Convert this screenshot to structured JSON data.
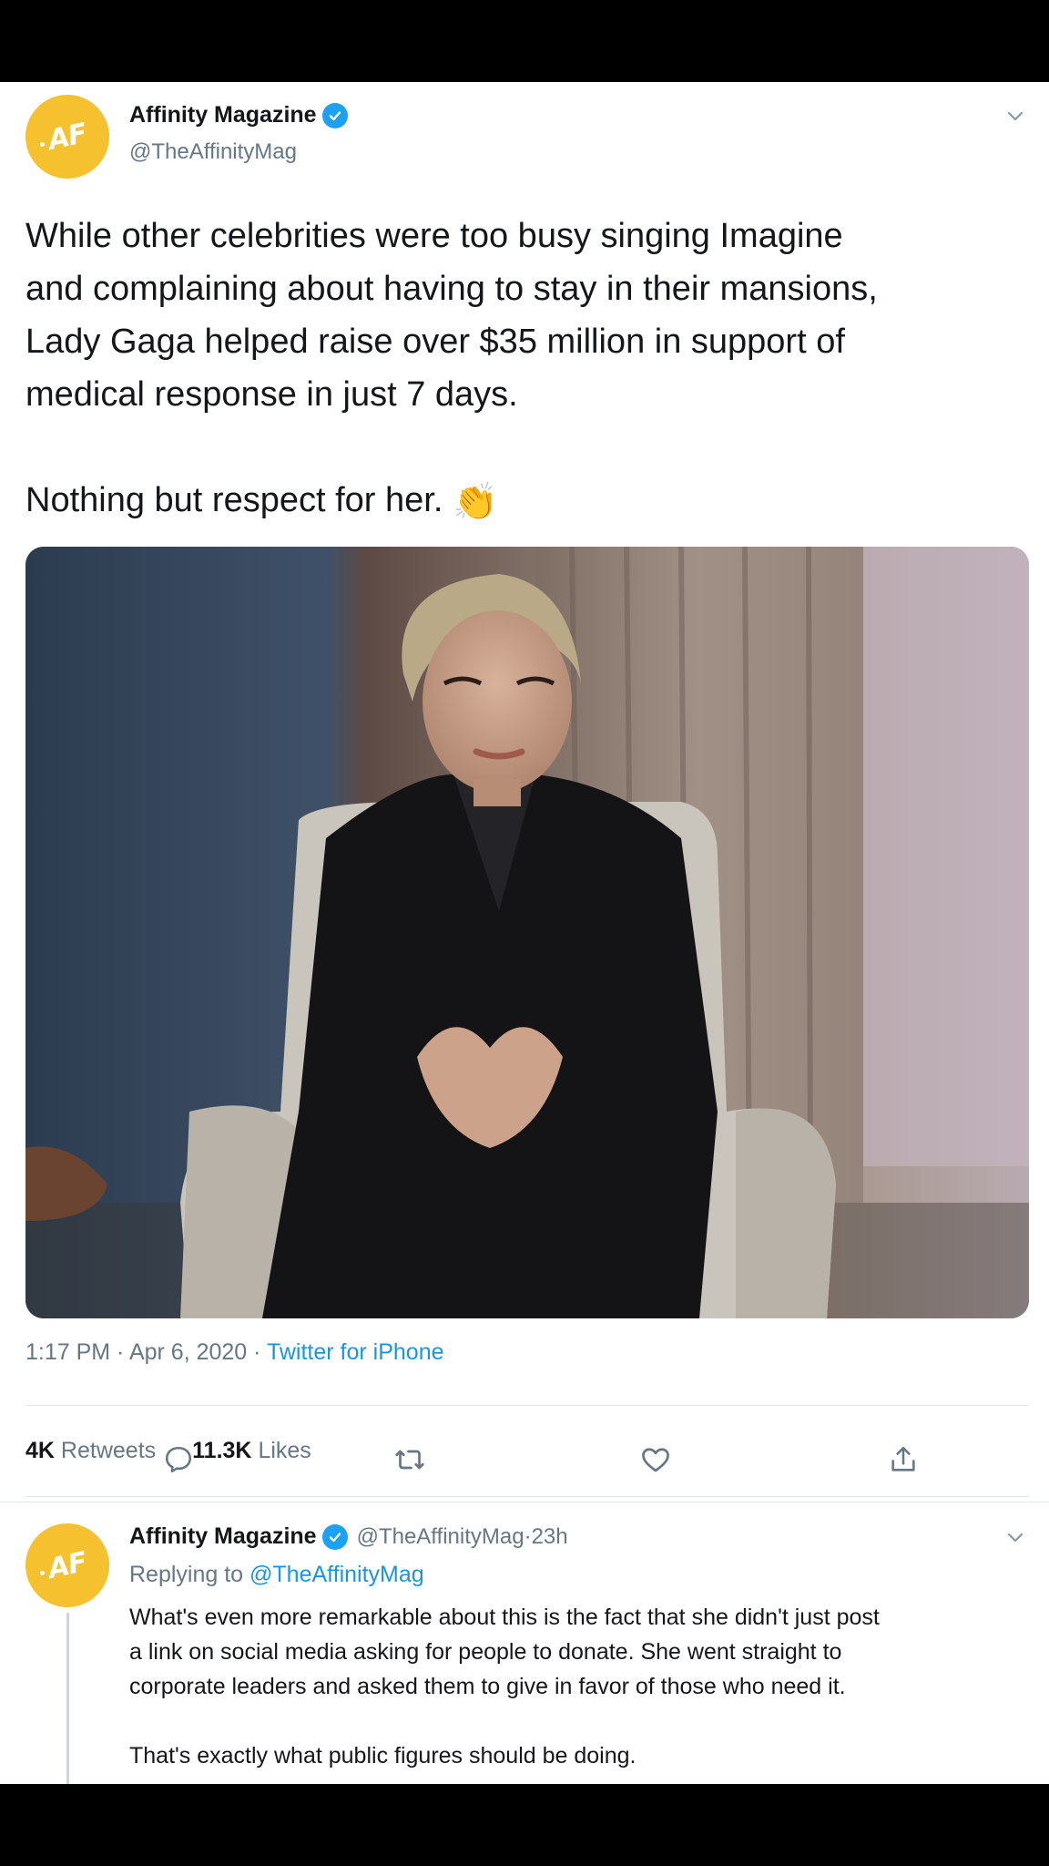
{
  "tweet": {
    "author_name": "Affinity Magazine",
    "author_handle": "@TheAffinityMag",
    "avatar_initials": "AF",
    "text_line1": "While other celebrities were too busy singing Imagine",
    "text_line2": "and complaining about having to stay in their mansions,",
    "text_line3": "Lady Gaga helped raise over $35 million in support of",
    "text_line4": "medical response in just 7 days.",
    "text_line5": "Nothing but respect for her.",
    "emoji": "👏",
    "time": "1:17 PM",
    "separator": " · ",
    "date": "Apr 6, 2020",
    "source": "Twitter for iPhone",
    "retweets_count": "4K",
    "retweets_label": "Retweets",
    "likes_count": "11.3K",
    "likes_label": "Likes"
  },
  "reply": {
    "author_name": "Affinity Magazine",
    "author_handle": "@TheAffinityMag",
    "age": "23h",
    "avatar_initials": "AF",
    "replying_prefix": "Replying to",
    "replying_to": "@TheAffinityMag",
    "line1": "What's even more remarkable about this is the fact that she didn't just post",
    "line2": "a link on social media asking for people to donate. She went straight to",
    "line3": "corporate leaders and asked them to give in favor of those who need it.",
    "line4": "That's exactly what public figures should be doing."
  },
  "colors": {
    "accent": "#1da1f2",
    "link": "#1b95e0",
    "avatar": "#f5c12e",
    "muted": "#657786"
  },
  "icons": [
    "verified-badge-icon",
    "chevron-down-icon",
    "reply-icon",
    "retweet-icon",
    "like-icon",
    "share-icon"
  ]
}
